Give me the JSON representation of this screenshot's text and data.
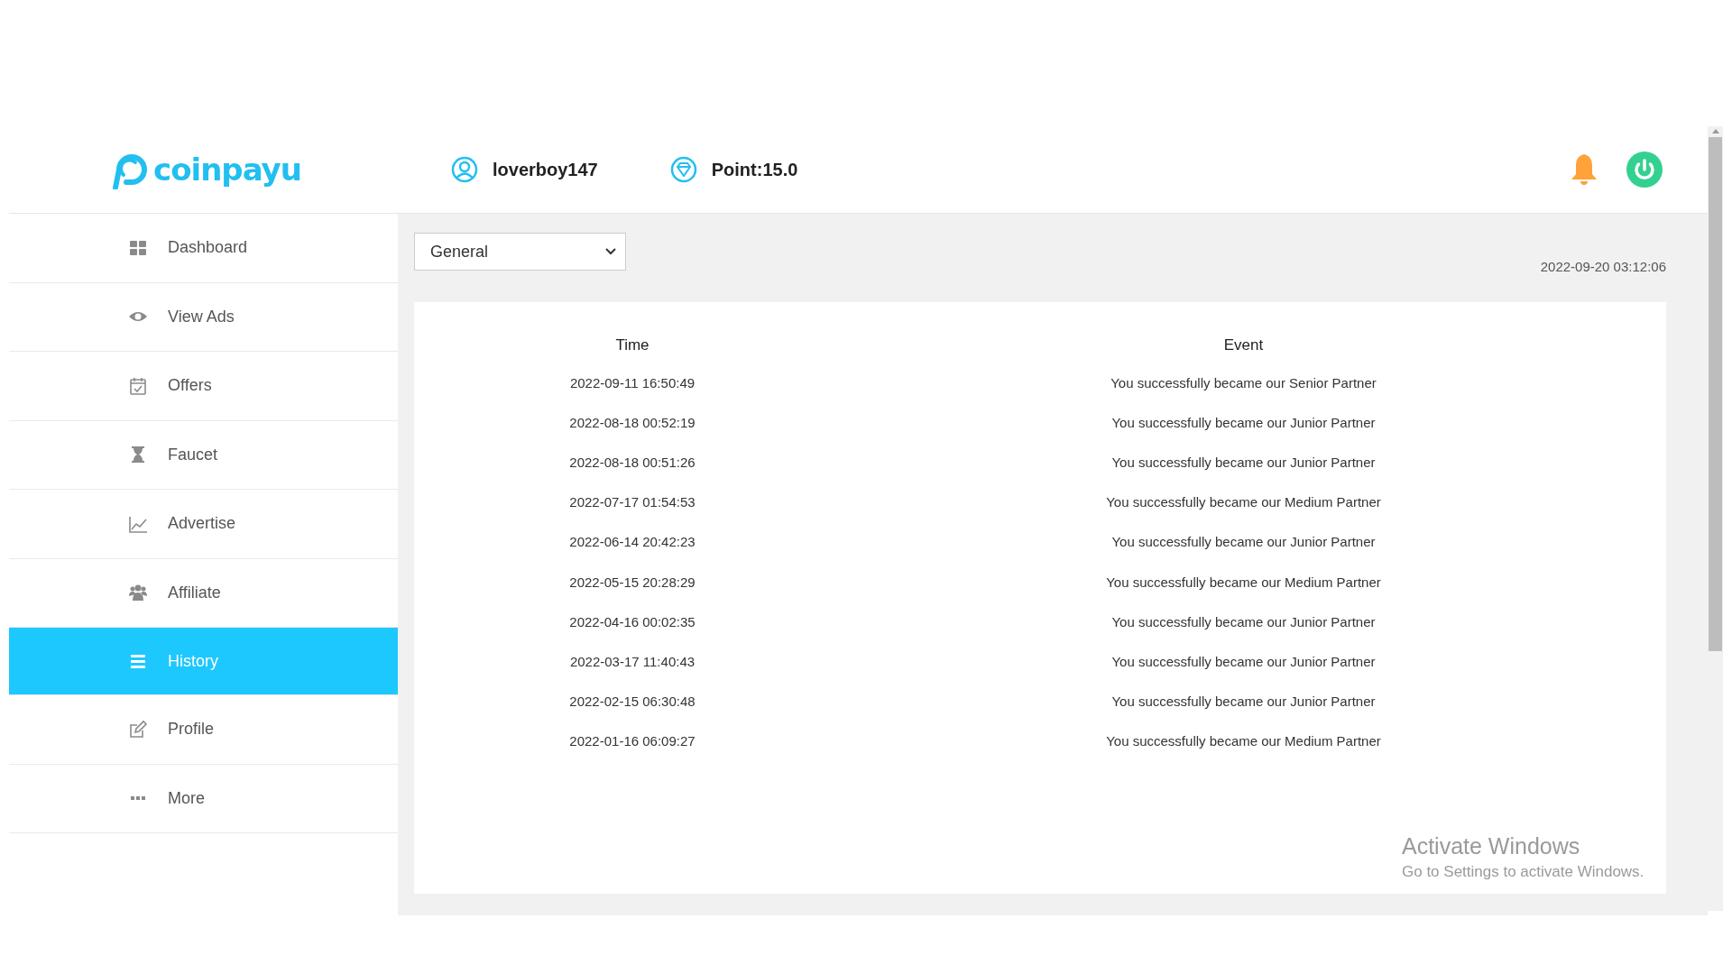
{
  "header": {
    "logo": "coinpayu",
    "username": "loverboy147",
    "points": "Point:15.0"
  },
  "sidebar": {
    "items": [
      {
        "label": "Dashboard",
        "selected": false
      },
      {
        "label": "View Ads",
        "selected": false
      },
      {
        "label": "Offers",
        "selected": false
      },
      {
        "label": "Faucet",
        "selected": false
      },
      {
        "label": "Advertise",
        "selected": false
      },
      {
        "label": "Affiliate",
        "selected": false
      },
      {
        "label": "History",
        "selected": true
      },
      {
        "label": "Profile",
        "selected": false
      },
      {
        "label": "More",
        "selected": false
      }
    ]
  },
  "filter": {
    "value": "General"
  },
  "current_time": "2022-09-20 03:12:06",
  "table": {
    "columns": [
      "Time",
      "Event"
    ],
    "rows": [
      [
        "2022-09-11 16:50:49",
        "You successfully became our Senior Partner"
      ],
      [
        "2022-08-18 00:52:19",
        "You successfully became our Junior Partner"
      ],
      [
        "2022-08-18 00:51:26",
        "You successfully became our Junior Partner"
      ],
      [
        "2022-07-17 01:54:53",
        "You successfully became our Medium Partner"
      ],
      [
        "2022-06-14 20:42:23",
        "You successfully became our Junior Partner"
      ],
      [
        "2022-05-15 20:28:29",
        "You successfully became our Medium Partner"
      ],
      [
        "2022-04-16 00:02:35",
        "You successfully became our Junior Partner"
      ],
      [
        "2022-03-17 11:40:43",
        "You successfully became our Junior Partner"
      ],
      [
        "2022-02-15 06:30:48",
        "You successfully became our Junior Partner"
      ],
      [
        "2022-01-16 06:09:27",
        "You successfully became our Medium Partner"
      ]
    ]
  },
  "os_notice": {
    "title": "Activate Windows",
    "subtitle": "Go to Settings to activate Windows."
  }
}
